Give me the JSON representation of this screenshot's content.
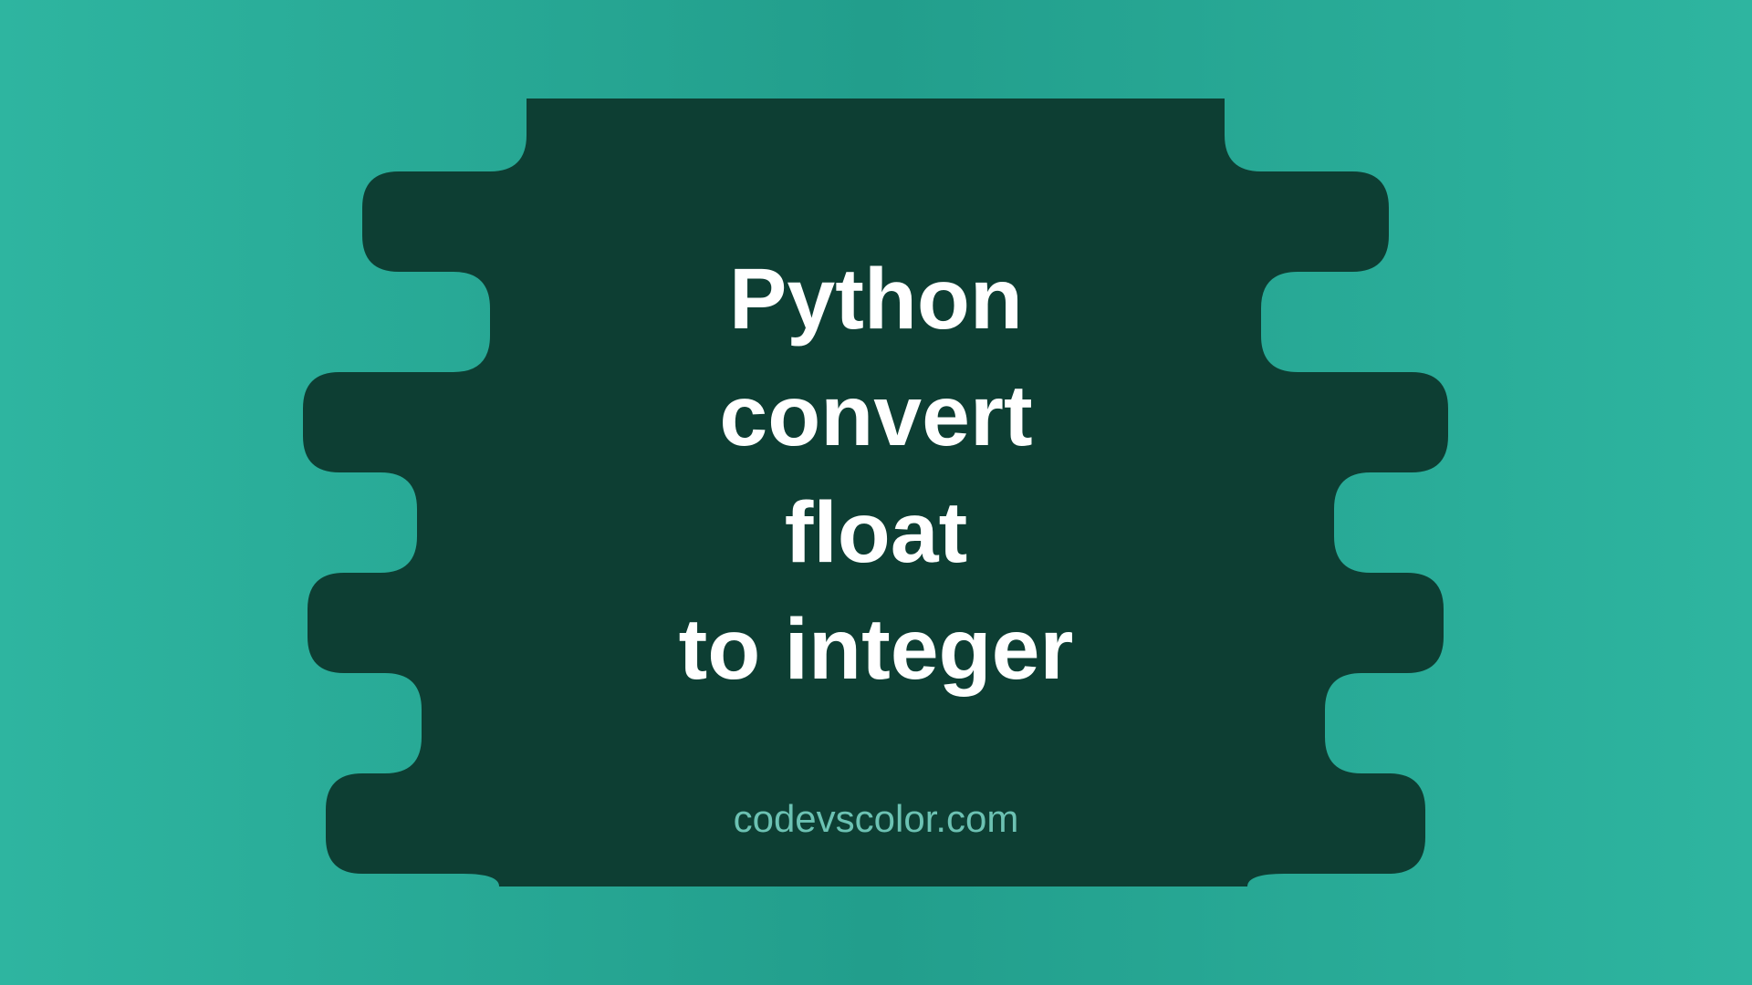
{
  "title": "Python\nconvert\nfloat\nto integer",
  "site_name": "codevscolor.com",
  "colors": {
    "background_teal": "#2eb5a0",
    "blob_dark": "#0d3e33",
    "title_text": "#ffffff",
    "site_text": "#6cc2b3"
  }
}
